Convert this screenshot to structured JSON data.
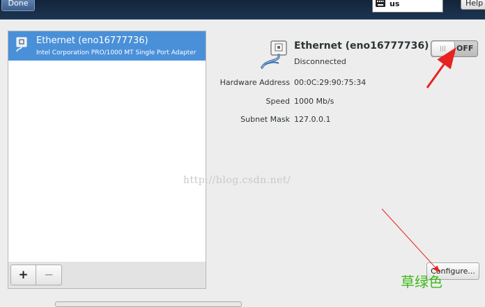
{
  "topbar": {
    "done_label": "Done",
    "keyboard_layout": "us",
    "help_label": "Help"
  },
  "device_list": {
    "items": [
      {
        "name": "Ethernet (eno16777736)",
        "description": "Intel Corporation PRO/1000 MT Single Port Adapter",
        "selected": true
      }
    ],
    "add_label": "+",
    "remove_label": "−"
  },
  "details": {
    "title": "Ethernet (eno16777736)",
    "status": "Disconnected",
    "toggle_label": "OFF",
    "toggle_on": false,
    "rows": [
      {
        "label": "Hardware Address",
        "value": "00:0C:29:90:75:34"
      },
      {
        "label": "Speed",
        "value": "1000 Mb/s"
      },
      {
        "label": "Subnet Mask",
        "value": "127.0.0.1"
      }
    ],
    "configure_label": "Configure..."
  },
  "annotations": {
    "watermark": "http://blog.csdn.net/",
    "caption": "草绿色",
    "arrow_color": "#e8231f",
    "caption_color": "#3cb819"
  },
  "colors": {
    "selection": "#4a90d9",
    "topbar": "#1c3553",
    "background": "#ededed"
  }
}
